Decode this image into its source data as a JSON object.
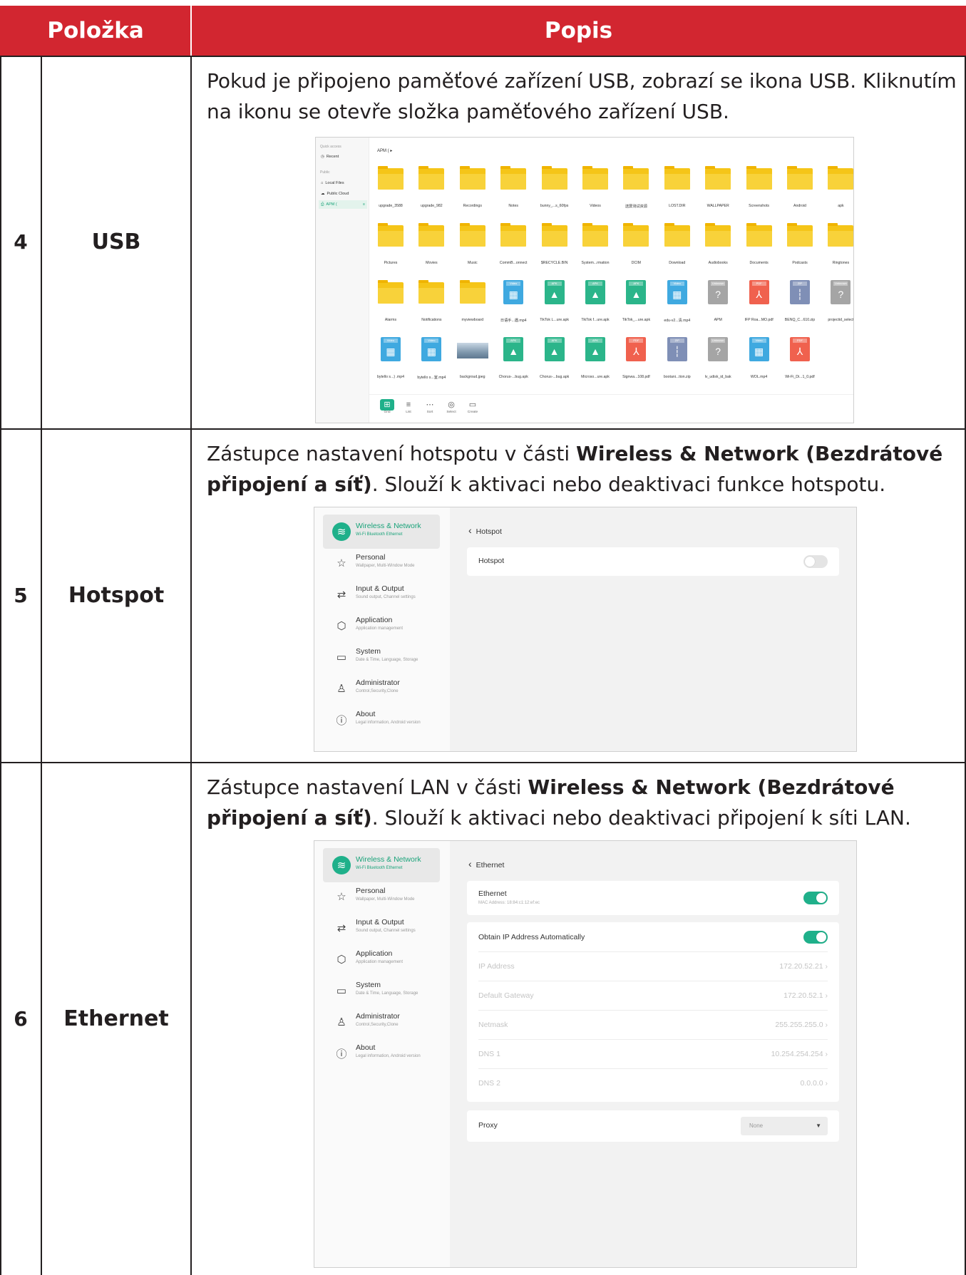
{
  "table": {
    "header": {
      "item": "Položka",
      "description": "Popis"
    },
    "rows": [
      {
        "number": "4",
        "item": "USB",
        "description": "Pokud je připojeno paměťové zařízení USB, zobrazí se ikona USB. Kliknutím na ikonu se otevře složka paměťového zařízení USB."
      },
      {
        "number": "5",
        "item": "Hotspot",
        "description_parts": [
          "Zástupce nastavení hotspotu v části ",
          "Wireless & Network (Bezdrátové připojení a síť)",
          ". Slouží k aktivaci nebo deaktivaci funkce hotspotu."
        ]
      },
      {
        "number": "6",
        "item": "Ethernet",
        "description_parts": [
          "Zástupce nastavení LAN v části ",
          "Wireless & Network (Bezdrátové připojení a síť)",
          ". Slouží k aktivaci nebo deaktivaci připojení k síti LAN."
        ]
      }
    ]
  },
  "file_manager": {
    "sidebar": {
      "quick_access": "Quick access",
      "recent": "Recent",
      "public": "Public",
      "local_files": "Local Files",
      "public_cloud": "Public Cloud",
      "apm": "APM   (",
      "apm_eject": "≡"
    },
    "path": "APM    (  ▸",
    "files": [
      {
        "name": "upgrade_3588",
        "type": "folder"
      },
      {
        "name": "upgrade_982",
        "type": "folder"
      },
      {
        "name": "Recordings",
        "type": "folder"
      },
      {
        "name": "Notes",
        "type": "folder"
      },
      {
        "name": "bunny_...s_60fps",
        "type": "folder"
      },
      {
        "name": "Videos",
        "type": "folder"
      },
      {
        "name": "送屏测试资源",
        "type": "folder"
      },
      {
        "name": "LOST.DIR",
        "type": "folder"
      },
      {
        "name": "WALLPAPER",
        "type": "folder"
      },
      {
        "name": "Screenshots",
        "type": "folder"
      },
      {
        "name": "Android",
        "type": "folder"
      },
      {
        "name": "apk",
        "type": "folder"
      },
      {
        "name": "Pictures",
        "type": "folder"
      },
      {
        "name": "Movies",
        "type": "folder"
      },
      {
        "name": "Music",
        "type": "folder"
      },
      {
        "name": "CommB...onnect",
        "type": "folder"
      },
      {
        "name": "$RECYCLE.BIN",
        "type": "folder"
      },
      {
        "name": "System...rmation",
        "type": "folder"
      },
      {
        "name": "DCIM",
        "type": "folder"
      },
      {
        "name": "Download",
        "type": "folder"
      },
      {
        "name": "Audiobooks",
        "type": "folder"
      },
      {
        "name": "Documents",
        "type": "folder"
      },
      {
        "name": "Podcasts",
        "type": "folder"
      },
      {
        "name": "Ringtones",
        "type": "folder"
      },
      {
        "name": "Alarms",
        "type": "folder"
      },
      {
        "name": "Notifications",
        "type": "folder"
      },
      {
        "name": "myviewboard",
        "type": "folder"
      },
      {
        "name": "日语手...遇.mp4",
        "type": "video",
        "tag": "Video"
      },
      {
        "name": "TikTok L...ure.apk",
        "type": "apk",
        "tag": "APK"
      },
      {
        "name": "TikTok f...ure.apk",
        "type": "apk",
        "tag": "APK"
      },
      {
        "name": "TikTok_...ure.apk",
        "type": "apk",
        "tag": "APK"
      },
      {
        "name": "edu-v2...清.mp4",
        "type": "video",
        "tag": "Video"
      },
      {
        "name": "APM",
        "type": "unknown",
        "tag": "Unknown"
      },
      {
        "name": "IFP Roa...MO.pdf",
        "type": "pdf",
        "tag": "PDF"
      },
      {
        "name": "BENQ_C...610.zip",
        "type": "zip",
        "tag": "ZIP"
      },
      {
        "name": "projectid_select",
        "type": "unknown",
        "tag": "Unknown"
      },
      {
        "name": "bytello s...) .mp4",
        "type": "video",
        "tag": "Video"
      },
      {
        "name": "bytello s...室.mp4",
        "type": "video",
        "tag": "Video"
      },
      {
        "name": "backgroud.jpeg",
        "type": "image"
      },
      {
        "name": "Chorus-...bug.apk",
        "type": "apk",
        "tag": "APK"
      },
      {
        "name": "Chorus-...bug.apk",
        "type": "apk",
        "tag": "APK"
      },
      {
        "name": "Microso...ure.apk",
        "type": "apk",
        "tag": "APK"
      },
      {
        "name": "Signwa...108.pdf",
        "type": "pdf",
        "tag": "PDF"
      },
      {
        "name": "bootani...tion.zip",
        "type": "zip",
        "tag": "ZIP"
      },
      {
        "name": "lv_udisk_id_bak",
        "type": "unknown",
        "tag": "Unknown"
      },
      {
        "name": "WOL.mp4",
        "type": "video",
        "tag": "Video"
      },
      {
        "name": "Wi-Fi_Di...1_0.pdf",
        "type": "pdf",
        "tag": "PDF"
      }
    ],
    "toolbar": [
      "Grid",
      "List",
      "Sort",
      "Select",
      "Create"
    ],
    "colors": {
      "video": "#3fa9e0",
      "apk": "#2bb58a",
      "pdf": "#f0614e",
      "zip": "#7f8fb6",
      "unknown": "#a5a5a5"
    }
  },
  "settings_menu": [
    {
      "title": "Wireless & Network",
      "subtitle": "Wi-Fi Bluetooth Ethernet",
      "icon": "wifi-icon"
    },
    {
      "title": "Personal",
      "subtitle": "Wallpaper, Multi-Window Mode",
      "icon": "star-icon"
    },
    {
      "title": "Input & Output",
      "subtitle": "Sound output, Channel settings",
      "icon": "arrows-icon"
    },
    {
      "title": "Application",
      "subtitle": "Application management",
      "icon": "cube-icon"
    },
    {
      "title": "System",
      "subtitle": "Date & Time, Language, Storage",
      "icon": "monitor-icon"
    },
    {
      "title": "Administrator",
      "subtitle": "Control,Security,Clone",
      "icon": "user-icon"
    },
    {
      "title": "About",
      "subtitle": "Legal information, Android version",
      "icon": "info-icon"
    }
  ],
  "hotspot_page": {
    "back_title": "Hotspot",
    "row_label": "Hotspot",
    "enabled": false
  },
  "ethernet_page": {
    "back_title": "Ethernet",
    "ethernet_label": "Ethernet",
    "mac": "MAC Address: 18:84:c1:12:ef:ec",
    "ethernet_enabled": true,
    "obtain_label": "Obtain IP Address Automatically",
    "obtain_enabled": true,
    "fields": [
      {
        "label": "IP Address",
        "value": "172.20.52.21"
      },
      {
        "label": "Default Gateway",
        "value": "172.20.52.1"
      },
      {
        "label": "Netmask",
        "value": "255.255.255.0"
      },
      {
        "label": "DNS 1",
        "value": "10.254.254.254"
      },
      {
        "label": "DNS 2",
        "value": "0.0.0.0"
      }
    ],
    "proxy_label": "Proxy",
    "proxy_value": "None"
  },
  "accent_color": "#1fb08a",
  "header_color": "#d22630"
}
